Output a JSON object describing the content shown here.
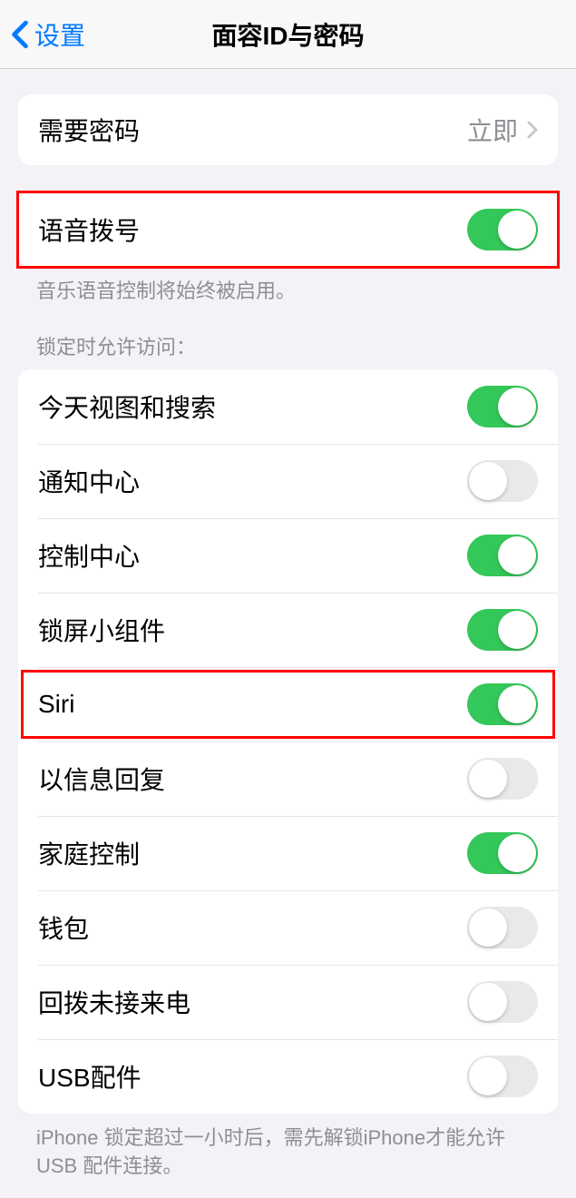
{
  "nav": {
    "back": "设置",
    "title": "面容ID与密码"
  },
  "section1": {
    "require_passcode_label": "需要密码",
    "require_passcode_value": "立即"
  },
  "section2": {
    "voice_dial_label": "语音拨号",
    "voice_dial_footer": "音乐语音控制将始终被启用。"
  },
  "section3": {
    "header": "锁定时允许访问：",
    "items": [
      {
        "label": "今天视图和搜索",
        "on": true
      },
      {
        "label": "通知中心",
        "on": false
      },
      {
        "label": "控制中心",
        "on": true
      },
      {
        "label": "锁屏小组件",
        "on": true
      },
      {
        "label": "Siri",
        "on": true
      },
      {
        "label": "以信息回复",
        "on": false
      },
      {
        "label": "家庭控制",
        "on": true
      },
      {
        "label": "钱包",
        "on": false
      },
      {
        "label": "回拨未接来电",
        "on": false
      },
      {
        "label": "USB配件",
        "on": false
      }
    ],
    "footer": "iPhone 锁定超过一小时后，需先解锁iPhone才能允许USB 配件连接。"
  }
}
